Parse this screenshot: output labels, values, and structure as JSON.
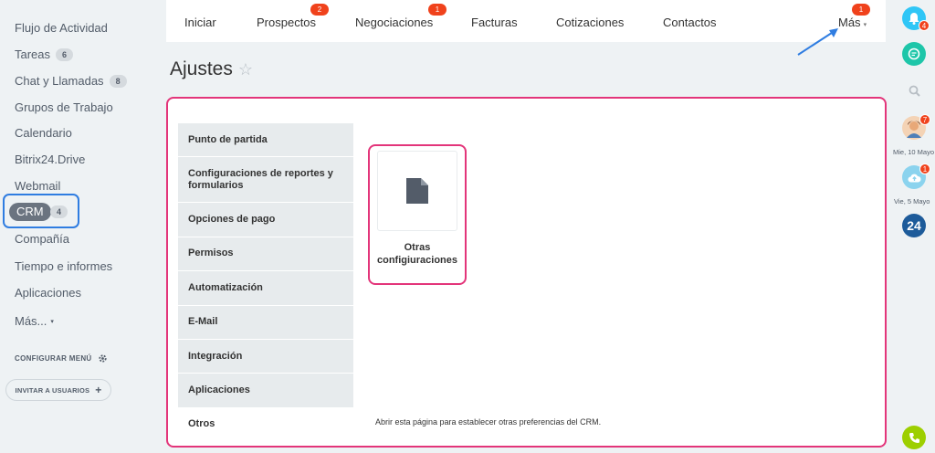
{
  "sidebar": {
    "items": [
      {
        "label": "Flujo de Actividad"
      },
      {
        "label": "Tareas",
        "count": "6"
      },
      {
        "label": "Chat y Llamadas",
        "count": "8"
      },
      {
        "label": "Grupos de Trabajo"
      },
      {
        "label": "Calendario"
      },
      {
        "label": "Bitrix24.Drive"
      },
      {
        "label": "Webmail"
      },
      {
        "label": "CRM",
        "count": "4"
      },
      {
        "label": "Compañía"
      },
      {
        "label": "Tiempo e informes"
      },
      {
        "label": "Aplicaciones"
      },
      {
        "label": "Más..."
      }
    ],
    "config_menu": "CONFIGURAR MENÚ",
    "invite": "INVITAR A USUARIOS"
  },
  "tabs": [
    {
      "label": "Iniciar"
    },
    {
      "label": "Prospectos",
      "badge": "2"
    },
    {
      "label": "Negociaciones",
      "badge": "1"
    },
    {
      "label": "Facturas"
    },
    {
      "label": "Cotizaciones"
    },
    {
      "label": "Contactos"
    },
    {
      "label": "Más",
      "badge": "1"
    }
  ],
  "page": {
    "title": "Ajustes",
    "star": "☆"
  },
  "settings_menu": [
    {
      "label": "Punto de partida"
    },
    {
      "label": "Configuraciones de reportes y formularios"
    },
    {
      "label": "Opciones de pago"
    },
    {
      "label": "Permisos"
    },
    {
      "label": "Automatización"
    },
    {
      "label": "E-Mail"
    },
    {
      "label": "Integración"
    },
    {
      "label": "Aplicaciones"
    },
    {
      "label": "Otros",
      "active": true
    }
  ],
  "tile": {
    "label": "Otras configiuraciones",
    "icon": "document-icon"
  },
  "description": "Abrir esta página para establecer otras preferencias del CRM.",
  "right_rail": {
    "notifications_badge": "4",
    "avatar_badge": "7",
    "date1": "Mie, 10 Mayo",
    "cloud_badge": "1",
    "date2": "Vie, 5 Mayo",
    "logo_text": "24"
  },
  "colors": {
    "accent_pink": "#e3357a",
    "accent_blue": "#2f7de1",
    "badge_red": "#f0421c"
  }
}
